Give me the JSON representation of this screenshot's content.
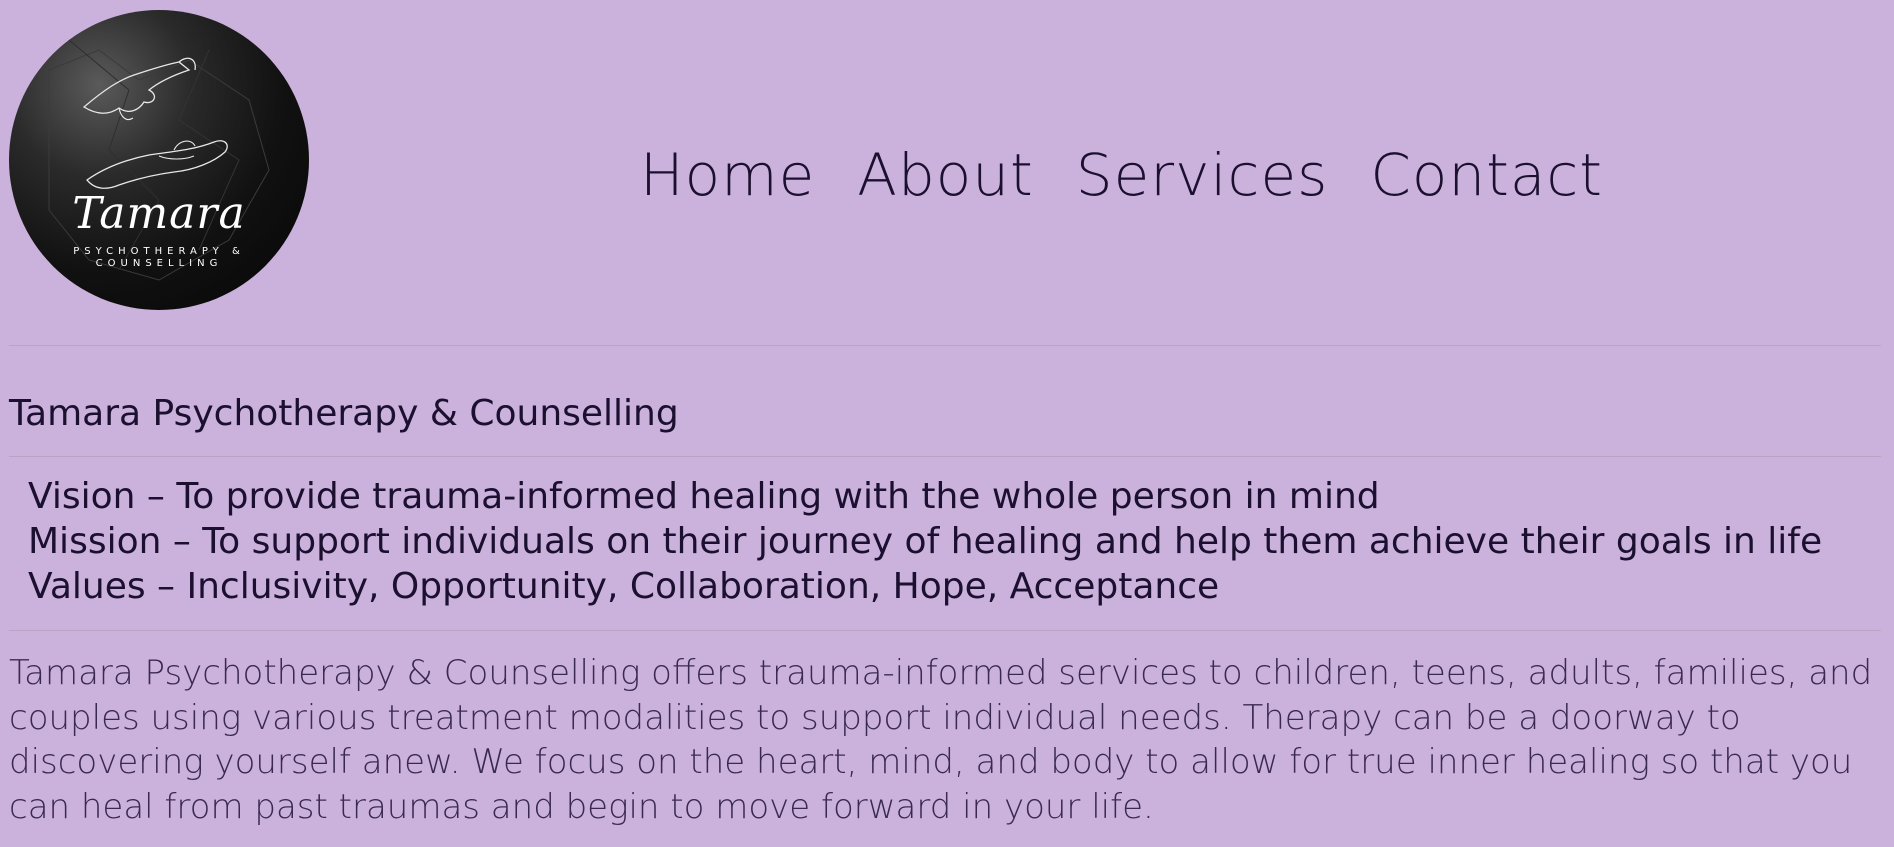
{
  "logo": {
    "script_text": "Tamara",
    "subtitle_line1": "PSYCHOTHERAPY &",
    "subtitle_line2": "COUNSELLING"
  },
  "nav": {
    "items": [
      {
        "label": "Home"
      },
      {
        "label": "About"
      },
      {
        "label": "Services"
      },
      {
        "label": "Contact"
      }
    ]
  },
  "page": {
    "title": "Tamara Psychotherapy & Counselling",
    "statements": [
      "Vision – To provide trauma-informed healing with the whole person in mind",
      "Mission – To support individuals on their journey of healing and help them achieve their goals in life",
      "Values – Inclusivity, Opportunity, Collaboration, Hope, Acceptance"
    ],
    "intro": "Tamara Psychotherapy & Counselling offers trauma-informed services to children, teens, adults, families, and couples using various treatment modalities to support individual needs. Therapy can be a doorway to discovering yourself anew. We focus on the heart, mind, and body to allow for true inner healing so that you can heal from past traumas and begin to move forward in your life."
  },
  "colors": {
    "background": "#cbb2dc",
    "text": "#1c1030",
    "divider": "#b7a5c3"
  }
}
